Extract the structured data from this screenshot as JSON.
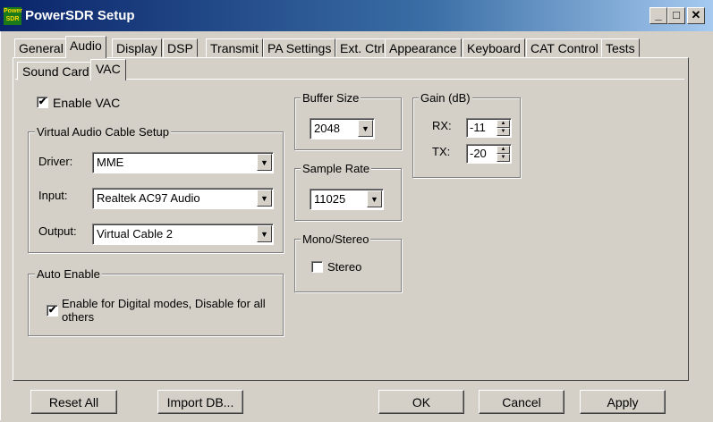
{
  "window": {
    "title": "PowerSDR Setup",
    "icon_label": "Power SDR",
    "icon": "powersdr-logo-icon",
    "controls": {
      "minimize": "_",
      "maximize": "□",
      "close": "✕"
    }
  },
  "tabs": [
    "General",
    "Audio",
    "Display",
    "DSP",
    "Transmit",
    "PA Settings",
    "Ext. Ctrl",
    "Appearance",
    "Keyboard",
    "CAT Control",
    "Tests"
  ],
  "active_tab": "Audio",
  "subtabs": [
    "Sound Card",
    "VAC"
  ],
  "active_subtab": "VAC",
  "enable_vac": {
    "label": "Enable VAC",
    "checked": true
  },
  "vac_setup": {
    "title": "Virtual Audio Cable Setup",
    "driver_label": "Driver:",
    "driver_value": "MME",
    "input_label": "Input:",
    "input_value": "Realtek AC97 Audio",
    "output_label": "Output:",
    "output_value": "Virtual Cable 2"
  },
  "auto_enable": {
    "title": "Auto Enable",
    "label": "Enable for Digital modes, Disable for all others",
    "checked": true
  },
  "buffer_size": {
    "title": "Buffer Size",
    "value": "2048"
  },
  "sample_rate": {
    "title": "Sample Rate",
    "value": "11025"
  },
  "mono_stereo": {
    "title": "Mono/Stereo",
    "label": "Stereo",
    "checked": false
  },
  "gain": {
    "title": "Gain (dB)",
    "rx_label": "RX:",
    "rx_value": "-11",
    "tx_label": "TX:",
    "tx_value": "-20"
  },
  "buttons": {
    "reset_all": "Reset All",
    "import_db": "Import DB...",
    "ok": "OK",
    "cancel": "Cancel",
    "apply": "Apply"
  },
  "glyphs": {
    "check": "✔",
    "drop": "▼",
    "up": "▲",
    "down": "▼"
  }
}
